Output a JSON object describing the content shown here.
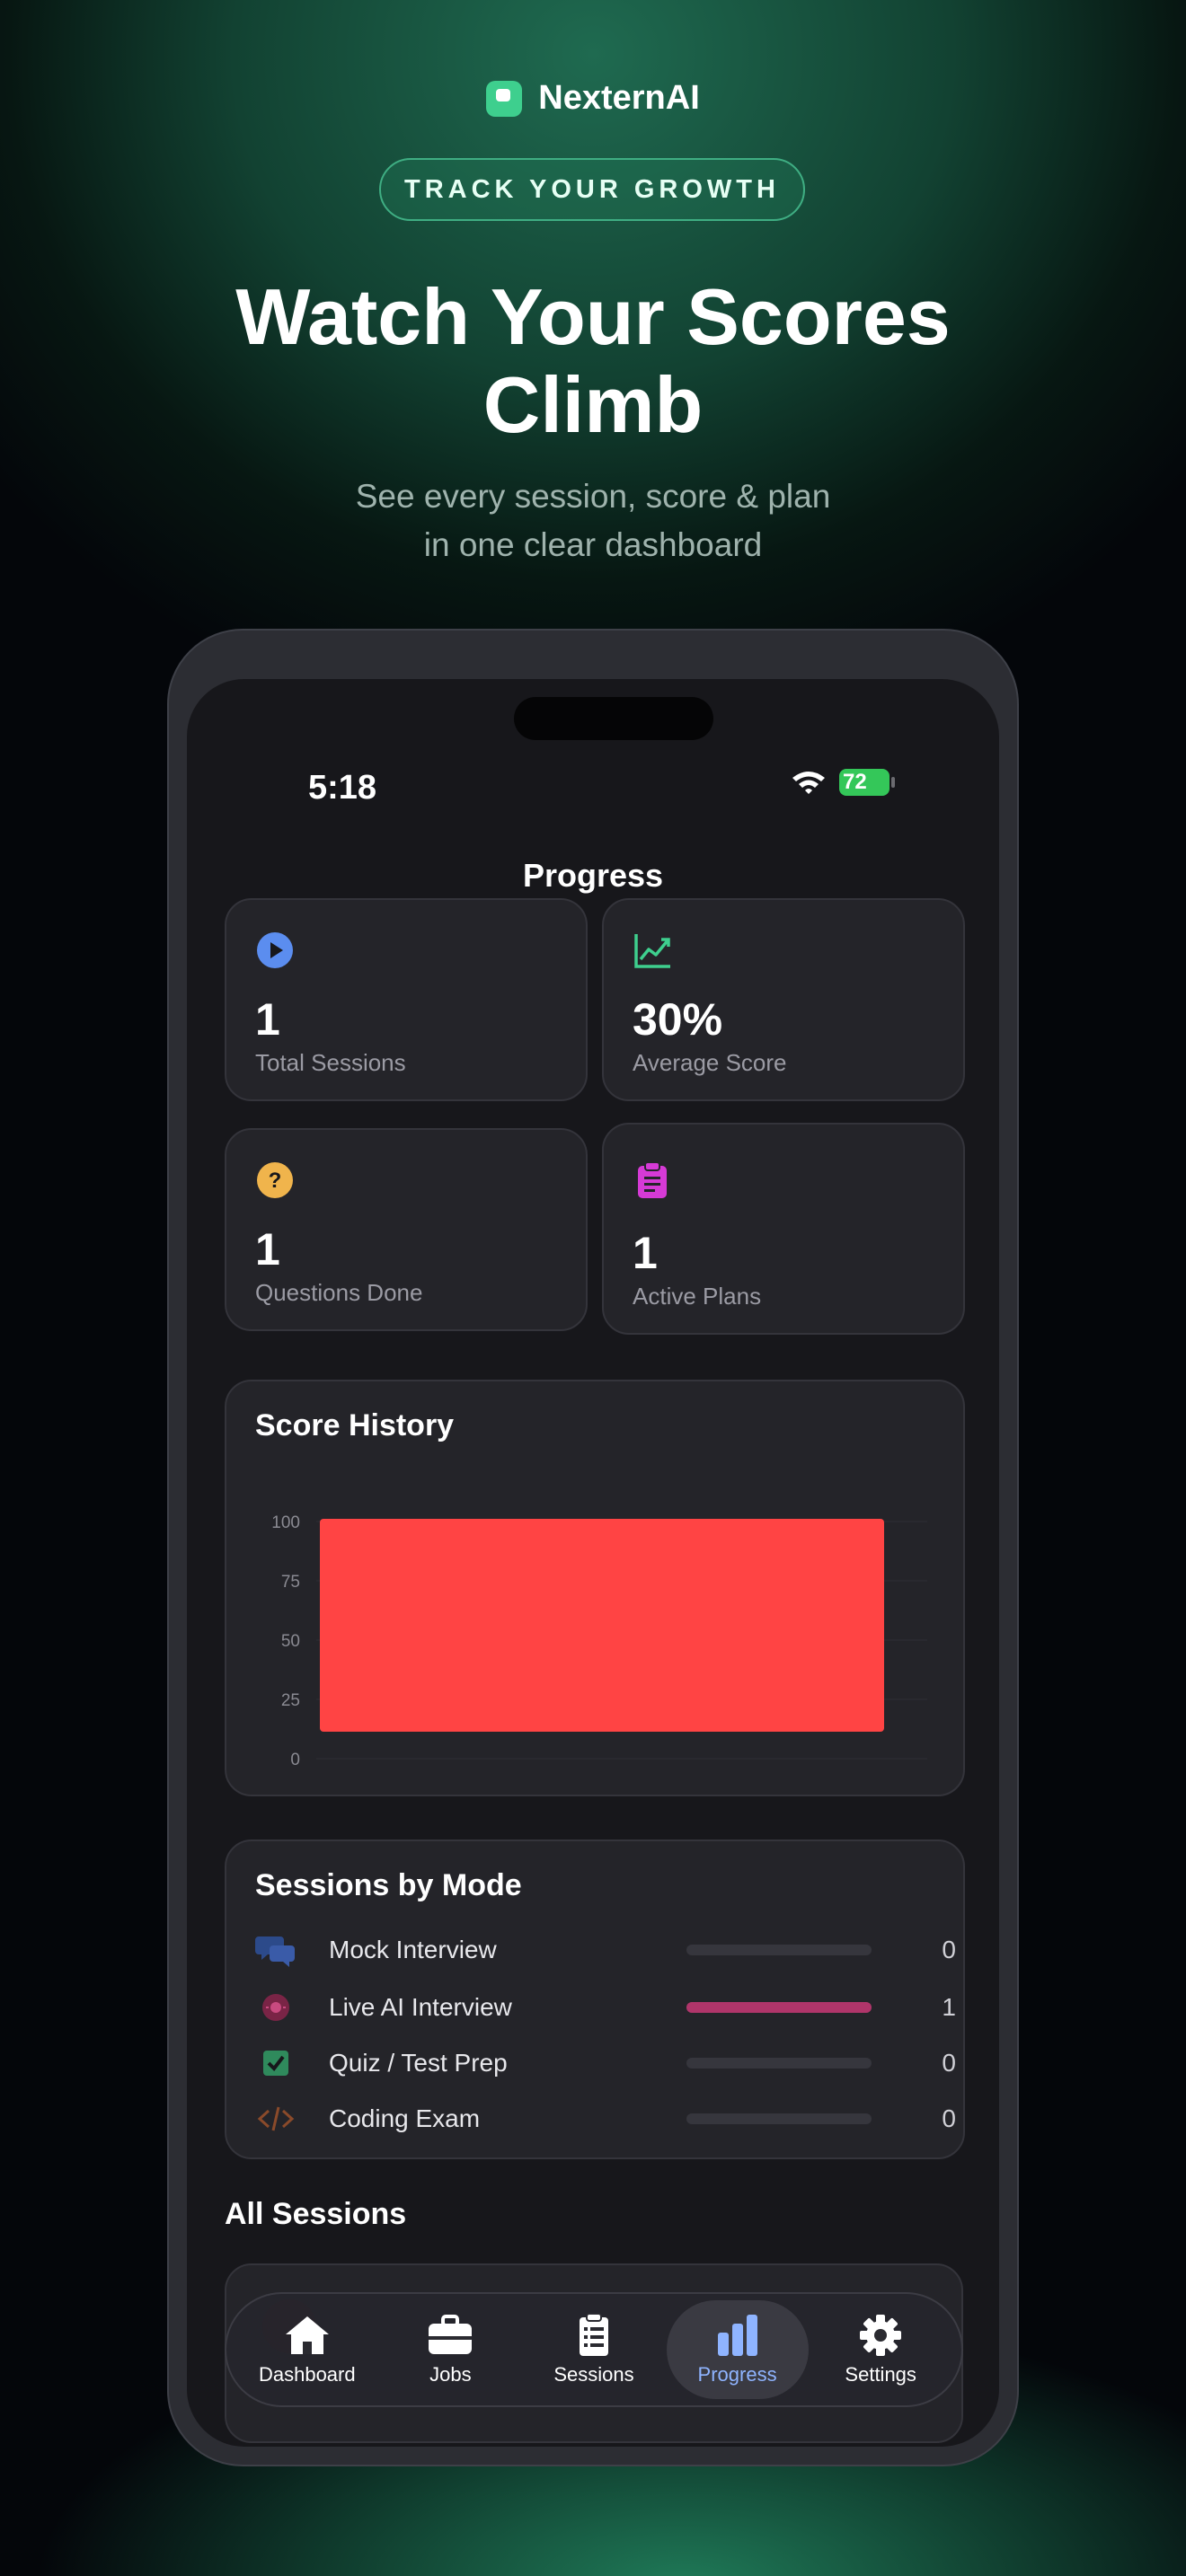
{
  "brand": {
    "name": "NexternAI",
    "accent": "#3ecf8e"
  },
  "pill": "TRACK YOUR GROWTH",
  "headline": {
    "line1": "Watch Your Scores",
    "line2": "Climb"
  },
  "subline": {
    "line1": "See every session, score & plan",
    "line2": "in one clear dashboard"
  },
  "status_bar": {
    "time": "5:18",
    "battery": "72"
  },
  "screen_title": "Progress",
  "stats": [
    {
      "value": "1",
      "label": "Total Sessions",
      "icon": "play-circle-icon",
      "color": "#5b8def"
    },
    {
      "value": "30%",
      "label": "Average Score",
      "icon": "trend-chart-icon",
      "color": "#3ecf8e"
    },
    {
      "value": "1",
      "label": "Questions Done",
      "icon": "question-circle-icon",
      "color": "#f0b44c"
    },
    {
      "value": "1",
      "label": "Active Plans",
      "icon": "clipboard-icon",
      "color": "#d63ad6"
    }
  ],
  "score_history": {
    "title": "Score History",
    "chart_data": {
      "type": "bar",
      "categories": [
        ""
      ],
      "values": [
        100
      ],
      "ylim": [
        0,
        100
      ],
      "yticks": [
        "100",
        "75",
        "50",
        "25",
        "0"
      ],
      "bar_color": "#ff4444",
      "grid": true
    }
  },
  "sessions_by_mode": {
    "title": "Sessions by Mode",
    "rows": [
      {
        "label": "Mock Interview",
        "count": "0",
        "fraction": 0,
        "icon": "chat-bubbles-icon",
        "color": "#2c4a8a"
      },
      {
        "label": "Live AI Interview",
        "count": "1",
        "fraction": 1,
        "icon": "live-record-icon",
        "color": "#b0356a"
      },
      {
        "label": "Quiz / Test Prep",
        "count": "0",
        "fraction": 0,
        "icon": "checkbox-icon",
        "color": "#2f8a5c"
      },
      {
        "label": "Coding Exam",
        "count": "0",
        "fraction": 0,
        "icon": "code-icon",
        "color": "#8a4a2a"
      }
    ]
  },
  "all_sessions": {
    "title": "All Sessions"
  },
  "tabs": [
    {
      "label": "Dashboard",
      "icon": "home-icon",
      "active": false
    },
    {
      "label": "Jobs",
      "icon": "briefcase-icon",
      "active": false
    },
    {
      "label": "Sessions",
      "icon": "list-clipboard-icon",
      "active": false
    },
    {
      "label": "Progress",
      "icon": "bar-chart-icon",
      "active": true
    },
    {
      "label": "Settings",
      "icon": "gear-icon",
      "active": false
    }
  ]
}
